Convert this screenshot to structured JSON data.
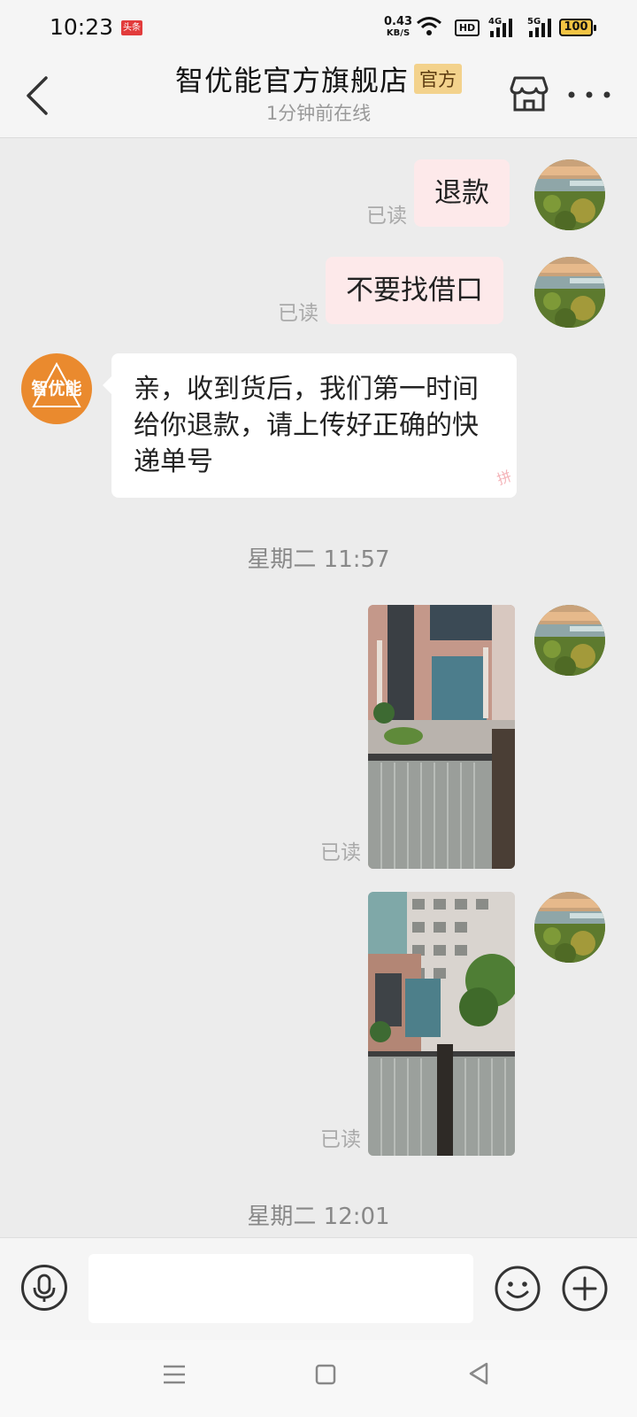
{
  "status_bar": {
    "time": "10:23",
    "news_badge": "头条",
    "net_speed_value": "0.43",
    "net_speed_unit": "KB/S",
    "hd_label": "HD",
    "signal1_label": "4G",
    "signal2_label": "5G",
    "battery": "100"
  },
  "header": {
    "title": "智优能官方旗舰店",
    "official_badge": "官方",
    "subtitle": "1分钟前在线",
    "icons": {
      "back": "back-chevron-icon",
      "shop": "store-icon",
      "more": "more-dots-icon"
    }
  },
  "messages": {
    "m1": {
      "text": "退款",
      "read": "已读"
    },
    "m2": {
      "text": "不要找借口",
      "read": "已读"
    },
    "m3": {
      "text": "亲，收到货后，我们第一时间给你退款，请上传好正确的快递单号",
      "avatar_text": "智优能",
      "mark": "拼"
    },
    "ts1": "星期二 11:57",
    "m4": {
      "read": "已读"
    },
    "m5": {
      "read": "已读"
    },
    "ts2": "星期二 12:01"
  },
  "input_bar": {
    "placeholder": "",
    "icons": {
      "voice": "microphone-icon",
      "emoji": "smiley-icon",
      "more": "plus-icon"
    }
  },
  "nav_bar": {
    "icons": {
      "menu": "menu-icon",
      "home": "home-square-icon",
      "back": "back-triangle-icon"
    }
  },
  "colors": {
    "user_bubble": "#fde9ea",
    "shop_bubble": "#ffffff",
    "background": "#ececec",
    "official_badge_bg": "#f3d28c",
    "shop_avatar": "#ea8a2e"
  }
}
